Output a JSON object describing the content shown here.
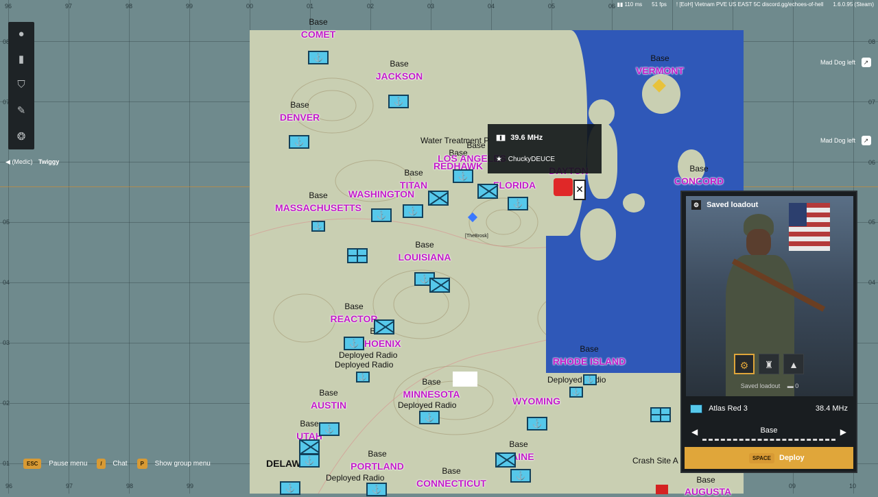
{
  "grid": {
    "x_labels": [
      "96",
      "97",
      "98",
      "99",
      "00",
      "01",
      "02",
      "03",
      "04",
      "05",
      "06",
      "07",
      "08",
      "09",
      "10"
    ],
    "y_labels": [
      "08",
      "07",
      "06",
      "05",
      "04",
      "03",
      "02",
      "01"
    ]
  },
  "status_bar": {
    "ping": "110 ms",
    "fps": "51 fps",
    "server": "! [EoH] Vietnam PVE US EAST 5C discord.gg/echoes-of-hell",
    "version": "1.6.0.95 (Steam)"
  },
  "toolbar": {
    "tools": [
      "info-icon",
      "marker-icon",
      "shield-icon",
      "pencil-icon",
      "brain-icon"
    ]
  },
  "player_tag": {
    "role": "(Medic)",
    "name": "Twiggy"
  },
  "radio_popup": {
    "frequency": "39.6 MHz",
    "player": "ChuckyDEUCE"
  },
  "bases": [
    {
      "prefix": "Base",
      "name": "COMET"
    },
    {
      "prefix": "Base",
      "name": "JACKSON"
    },
    {
      "prefix": "Base",
      "name": "DENVER"
    },
    {
      "prefix": "Base",
      "name": "VERMONT"
    },
    {
      "prefix": "Base",
      "name": "MASSACHUSETTS"
    },
    {
      "prefix": "Base",
      "name": "WASHINGTON"
    },
    {
      "prefix": "Base",
      "name": "TITAN"
    },
    {
      "prefix": "Base",
      "name": "REDHAWK"
    },
    {
      "prefix": "Base",
      "name": "LOS ANGELES"
    },
    {
      "prefix": "Base",
      "name": "FLORIDA"
    },
    {
      "prefix": "Base",
      "name": "DAYTON"
    },
    {
      "prefix": "Base",
      "name": "CONCORD"
    },
    {
      "prefix": "Base",
      "name": "LOUISIANA"
    },
    {
      "prefix": "Base",
      "name": "REACTOR"
    },
    {
      "prefix": "Base",
      "name": "PHOENIX"
    },
    {
      "prefix": "Base",
      "name": "RHODE ISLAND"
    },
    {
      "prefix": "Base",
      "name": "AUSTIN"
    },
    {
      "prefix": "Base",
      "name": "MINNESOTA"
    },
    {
      "prefix": "Base",
      "name": "WYOMING"
    },
    {
      "prefix": "Base",
      "name": "UTAH"
    },
    {
      "prefix": "Base",
      "name": "PORTLAND"
    },
    {
      "prefix": "Base",
      "name": "MAINE"
    },
    {
      "prefix": "Base",
      "name": "CONNECTICUT"
    },
    {
      "prefix": "Base",
      "name": "AUGUSTA"
    }
  ],
  "pois": {
    "water_treatment": "Water Treatment P",
    "deployed_radio": "Deployed Radio",
    "crash_site": "Crash Site A",
    "delaware": "DELAW",
    "the_brosk": "[TheBrosk]"
  },
  "mad_dog": {
    "text": "Mad Dog left"
  },
  "panel": {
    "title": "Saved loadout",
    "saved_loadout_label": "Saved loadout",
    "saved_loadout_count": "0",
    "group": "Atlas Red 3",
    "group_freq": "38.4 MHz",
    "spawn_point": "Base",
    "deploy_key": "SPACE",
    "deploy_label": "Deploy"
  },
  "hints": [
    {
      "key": "ESC",
      "label": "Pause menu"
    },
    {
      "key": "/",
      "label": "Chat"
    },
    {
      "key": "P",
      "label": "Show group menu"
    }
  ]
}
